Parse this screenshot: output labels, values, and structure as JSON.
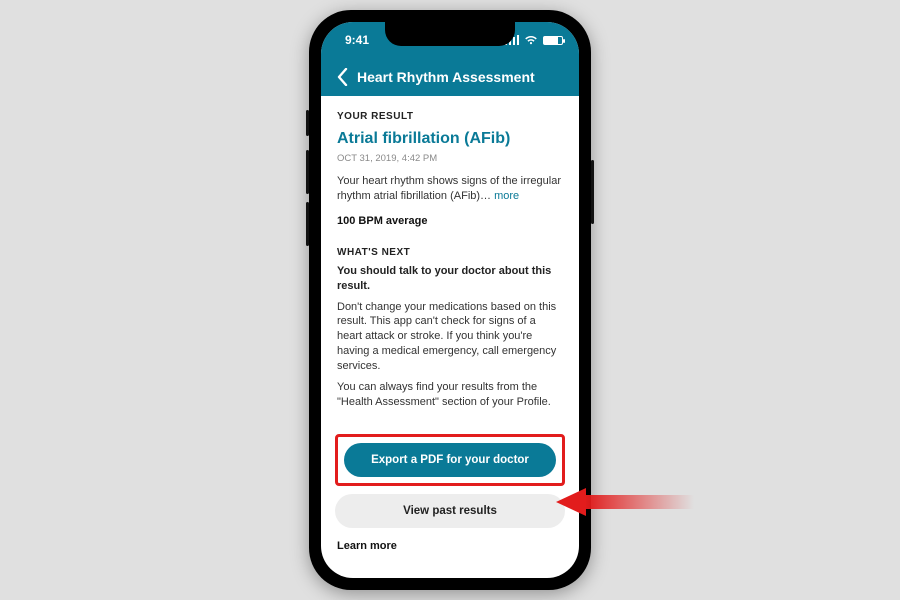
{
  "status": {
    "time": "9:41"
  },
  "nav": {
    "title": "Heart Rhythm Assessment"
  },
  "result": {
    "section_label": "YOUR RESULT",
    "title": "Atrial fibrillation (AFib)",
    "timestamp": "OCT 31, 2019, 4:42 PM",
    "summary": "Your heart rhythm shows signs of the irregular rhythm atrial fibrillation (AFib)… ",
    "more": "more",
    "bpm": "100 BPM average"
  },
  "next": {
    "section_label": "WHAT'S NEXT",
    "headline": "You should talk to your doctor about this result.",
    "para1": "Don't change your medications based on this result. This app can't check for signs of a heart attack or stroke. If you think you're having a medical emergency, call emergency services.",
    "para2": "You can always find your results from the \"Health Assessment\" section of your Profile."
  },
  "buttons": {
    "export": "Export a PDF for your doctor",
    "past": "View past results"
  },
  "footer": {
    "learn": "Learn more"
  }
}
